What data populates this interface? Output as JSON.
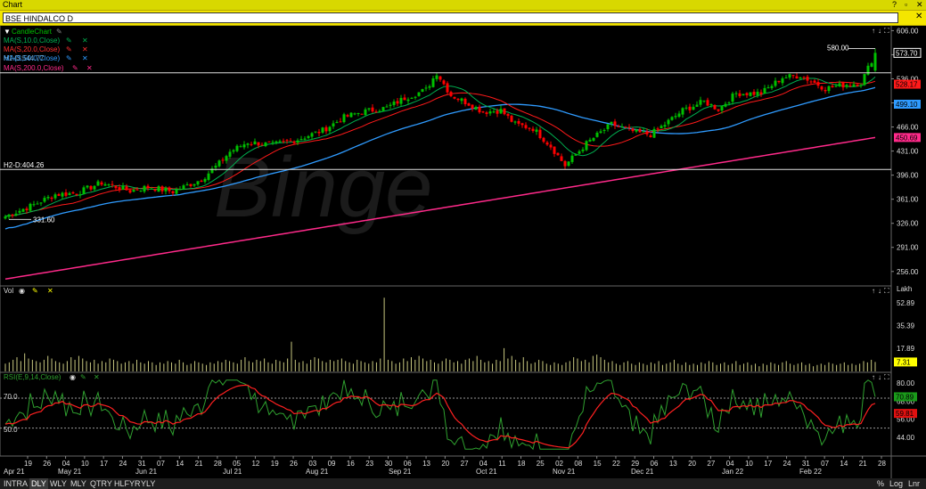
{
  "window": {
    "title": "Chart",
    "symbol": "BSE HINDALCO D"
  },
  "legend": {
    "candle": "CandleChart",
    "ma10": "MA(S,10.0,Close)",
    "ma20": "MA(S,20.0,Close)",
    "ma50": "MA(S,50.0,Close)",
    "ma200": "MA(S,200.0,Close)",
    "ma50_overlay": "H1-D:544.77"
  },
  "annotations": {
    "h1_label": "H1-D:544.77",
    "h2_label": "H2-D:404.26",
    "high_label": "580.00",
    "low_label": "331.60"
  },
  "price_badges": {
    "close": "573.70",
    "ma20": "528.17",
    "ma50": "499.10",
    "ma200": "450.69"
  },
  "panels": {
    "vol_label": "Vol",
    "vol_unit": "Lakh",
    "vol_badge": "7.31",
    "rsi_label": "RSI(E,9,14,Close)",
    "rsi_badge_1": "70.89",
    "rsi_badge_2": "59.81",
    "rsi_level_70": "70.0",
    "rsi_level_50": "50.0"
  },
  "toolbar": {
    "buttons": [
      "INTRA",
      "DLY",
      "WLY",
      "MLY",
      "QTRY",
      "HLFYR",
      "YLY"
    ],
    "active": "DLY",
    "right": [
      "%",
      "Log",
      "Lnr"
    ]
  },
  "colors": {
    "up": "#00c000",
    "down": "#ff0000",
    "ma10": "#00b050",
    "ma20": "#ff1a1a",
    "ma50": "#2f9bff",
    "ma200": "#ff2a8a",
    "vol": "#c8c880",
    "rsi": "#2fa02f",
    "rsi_signal": "#ff2020"
  },
  "chart_data": {
    "type": "candlestick",
    "price_axis": {
      "ticks": [
        "606.00",
        "571.00",
        "536.00",
        "501.00",
        "466.00",
        "431.00",
        "396.00",
        "361.00",
        "326.00",
        "291.00",
        "256.00"
      ],
      "range": [
        235,
        613
      ]
    },
    "volume_axis": {
      "ticks": [
        "52.89",
        "35.39",
        "17.89"
      ],
      "range": [
        0,
        62
      ]
    },
    "rsi_axis": {
      "ticks": [
        "80.00",
        "68.00",
        "56.00",
        "44.00"
      ],
      "range": [
        32,
        86
      ],
      "levels": [
        70,
        50
      ]
    },
    "x_ticks": [
      "19",
      "26",
      "04",
      "10",
      "17",
      "24",
      "31",
      "07",
      "14",
      "21",
      "28",
      "05",
      "12",
      "19",
      "26",
      "03",
      "09",
      "16",
      "23",
      "30",
      "06",
      "13",
      "20",
      "27",
      "04",
      "11",
      "18",
      "25",
      "02",
      "08",
      "15",
      "22",
      "29",
      "06",
      "13",
      "20",
      "27",
      "04",
      "10",
      "17",
      "24",
      "31",
      "07",
      "14",
      "21",
      "28"
    ],
    "month_labels": [
      "Apr 21",
      "May 21",
      "Jun 21",
      "Jul 21",
      "Aug 21",
      "Sep 21",
      "Oct 21",
      "Nov 21",
      "Dec 21",
      "Jan 22",
      "Feb 22"
    ],
    "price_anchors": [
      [
        0,
        336
      ],
      [
        8,
        353
      ],
      [
        14,
        368
      ],
      [
        20,
        370
      ],
      [
        27,
        385
      ],
      [
        35,
        373
      ],
      [
        40,
        379
      ],
      [
        47,
        372
      ],
      [
        55,
        390
      ],
      [
        60,
        413
      ],
      [
        63,
        430
      ],
      [
        68,
        444
      ],
      [
        75,
        440
      ],
      [
        82,
        448
      ],
      [
        89,
        461
      ],
      [
        95,
        480
      ],
      [
        100,
        488
      ],
      [
        107,
        494
      ],
      [
        112,
        508
      ],
      [
        118,
        520
      ],
      [
        121,
        545
      ],
      [
        125,
        512
      ],
      [
        130,
        500
      ],
      [
        134,
        488
      ],
      [
        139,
        490
      ],
      [
        143,
        470
      ],
      [
        148,
        464
      ],
      [
        153,
        438
      ],
      [
        157,
        410
      ],
      [
        163,
        442
      ],
      [
        170,
        470
      ],
      [
        177,
        458
      ],
      [
        181,
        455
      ],
      [
        185,
        470
      ],
      [
        190,
        490
      ],
      [
        196,
        503
      ],
      [
        200,
        492
      ],
      [
        205,
        515
      ],
      [
        212,
        515
      ],
      [
        218,
        538
      ],
      [
        223,
        541
      ],
      [
        230,
        522
      ],
      [
        236,
        528
      ],
      [
        240,
        530
      ],
      [
        244,
        573.7
      ]
    ],
    "volume_samples": [
      6,
      7,
      9,
      11,
      8,
      14,
      10,
      9,
      8,
      7,
      9,
      12,
      10,
      8,
      7,
      6,
      8,
      11,
      9,
      12,
      10,
      8,
      7,
      9,
      6,
      8,
      7,
      10,
      9,
      8,
      6,
      7,
      8,
      6,
      9,
      7,
      6,
      8,
      7,
      5,
      7,
      6,
      8,
      7,
      6,
      9,
      7,
      5,
      6,
      8,
      7,
      6,
      5,
      7,
      6,
      8,
      7,
      9,
      8,
      7,
      6,
      9,
      11,
      8,
      7,
      9,
      8,
      10,
      7,
      6,
      9,
      8,
      7,
      10,
      23,
      9,
      7,
      8,
      6,
      9,
      11,
      10,
      8,
      7,
      9,
      8,
      9,
      10,
      8,
      7,
      6,
      9,
      8,
      7,
      6,
      8,
      7,
      10,
      57,
      9,
      8,
      6,
      7,
      10,
      8,
      11,
      9,
      12,
      10,
      8,
      9,
      7,
      6,
      8,
      10,
      9,
      7,
      8,
      6,
      9,
      10,
      8,
      12,
      9,
      7,
      8,
      6,
      9,
      8,
      18,
      10,
      12,
      9,
      7,
      11,
      8,
      6,
      7,
      9,
      8,
      6,
      5,
      7,
      6,
      5,
      7,
      8,
      11,
      10,
      8,
      9,
      7,
      12,
      13,
      11,
      9,
      7,
      8,
      6,
      5,
      7,
      8,
      6,
      5,
      7,
      6,
      5,
      7,
      6,
      8,
      5,
      6,
      7,
      9,
      6,
      5,
      7,
      5,
      6,
      5,
      7,
      6,
      8,
      7,
      5,
      6,
      7,
      5,
      6,
      8,
      5,
      6,
      7,
      5,
      6,
      4,
      6,
      5,
      7,
      6,
      5,
      7,
      8,
      6,
      5,
      6,
      7,
      5,
      6,
      4,
      5,
      6,
      5,
      7,
      6,
      5,
      6,
      7,
      5,
      6,
      5,
      6,
      8,
      7,
      9,
      7.31
    ]
  }
}
